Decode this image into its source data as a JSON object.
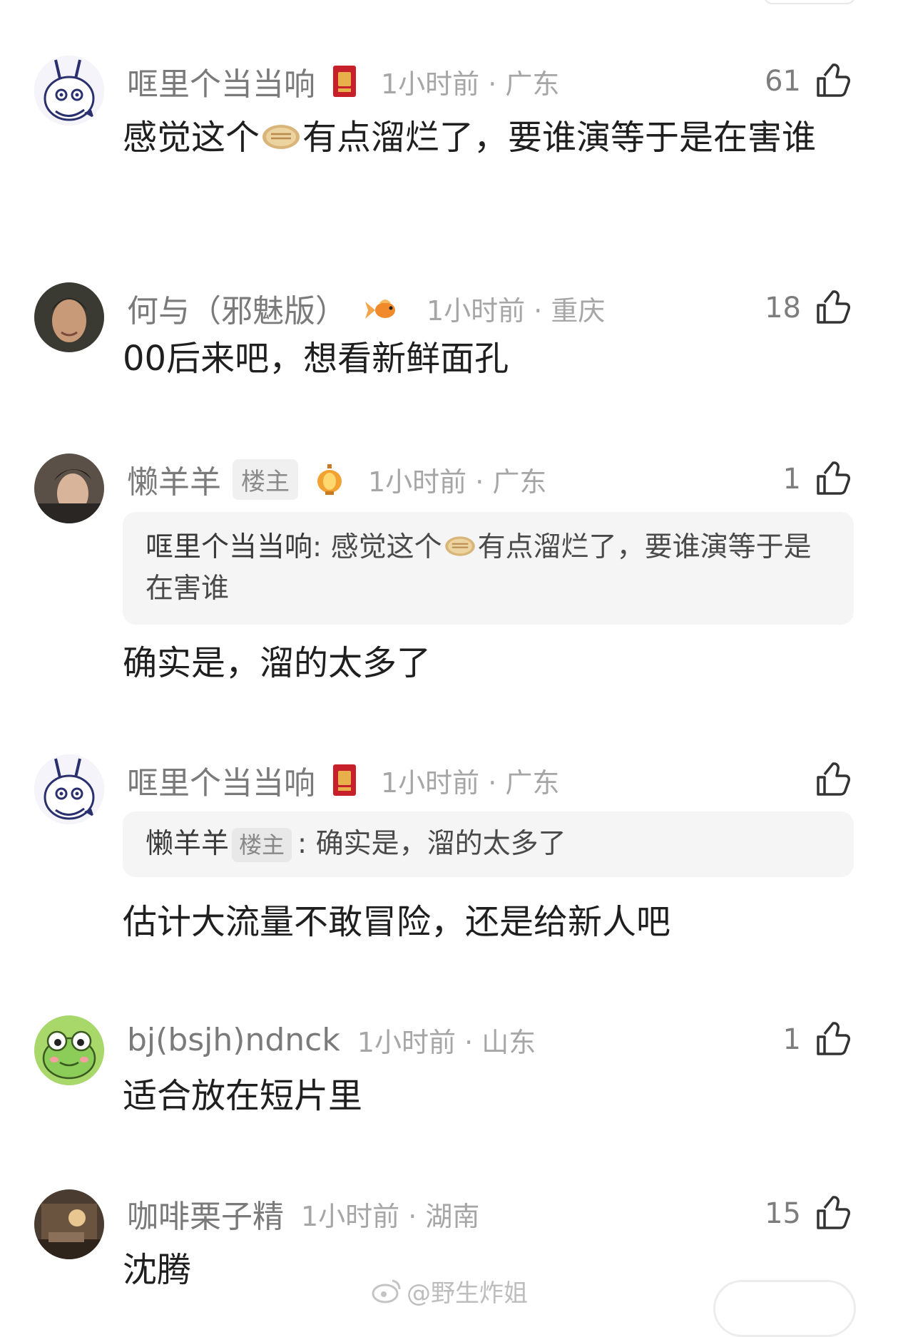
{
  "comments": [
    {
      "username": "哐里个当当响",
      "badge": "red-envelope-icon",
      "meta": "1小时前 · 广东",
      "likes": "61",
      "text_before": "感觉这个",
      "emoji": "pancake-emoji",
      "text_after": "有点溜烂了，要谁演等于是在害谁"
    },
    {
      "username": "何与（邪魅版）",
      "badge": "goldfish-icon",
      "meta": "1小时前 · 重庆",
      "likes": "18",
      "text": "00后来吧，想看新鲜面孔"
    },
    {
      "username": "懒羊羊",
      "tag": "楼主",
      "badge": "lantern-icon",
      "meta": "1小时前 · 广东",
      "likes": "1",
      "quote": {
        "name": "哐里个当当响",
        "sep": ": ",
        "text_before": "感觉这个",
        "emoji": "pancake-emoji",
        "text_after": "有点溜烂了，要谁演等于是在害谁"
      },
      "text": "确实是，溜的太多了"
    },
    {
      "username": "哐里个当当响",
      "badge": "red-envelope-icon",
      "meta": "1小时前 · 广东",
      "likes": "",
      "quote": {
        "name": "懒羊羊",
        "tag": "楼主",
        "sep": ": ",
        "text": "确实是，溜的太多了"
      },
      "text": "估计大流量不敢冒险，还是给新人吧"
    },
    {
      "username": "bj(bsjh)ndnck",
      "meta": "1小时前 · 山东",
      "likes": "1",
      "text": "适合放在短片里"
    },
    {
      "username": "咖啡栗子精",
      "meta": "1小时前 · 湖南",
      "likes": "15",
      "text": "沈腾"
    }
  ],
  "watermark": "@野生炸姐",
  "colors": {
    "username": "#7a7a7a",
    "meta": "#a6a6a6",
    "body": "#1f1f1f",
    "quote_bg": "#f5f5f5"
  }
}
